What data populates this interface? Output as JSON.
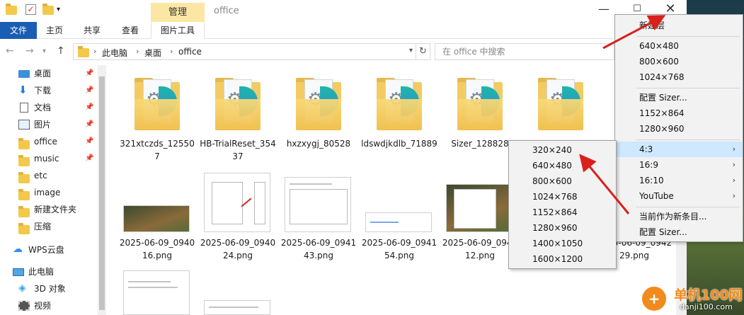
{
  "titlebar": {
    "manage_tab": "管理",
    "window_title": "office",
    "min_glyph": "—",
    "max_glyph": "☐",
    "close_glyph": "✕"
  },
  "ribbon": {
    "tabs": [
      "文件",
      "主页",
      "共享",
      "查看",
      "图片工具"
    ]
  },
  "address": {
    "crumbs": [
      "此电脑",
      "桌面",
      "office"
    ],
    "separator": "›",
    "search_placeholder": "在 office 中搜索"
  },
  "sidebar": {
    "items": [
      {
        "label": "桌面",
        "icon": "desktop-icon",
        "pinned": true
      },
      {
        "label": "下载",
        "icon": "download-icon",
        "pinned": true
      },
      {
        "label": "文档",
        "icon": "document-icon",
        "pinned": true
      },
      {
        "label": "图片",
        "icon": "picture-icon",
        "pinned": true
      },
      {
        "label": "office",
        "icon": "folder-icon",
        "pinned": true
      },
      {
        "label": "music",
        "icon": "folder-icon",
        "pinned": true
      },
      {
        "label": "etc",
        "icon": "folder-icon",
        "pinned": false
      },
      {
        "label": "image",
        "icon": "folder-icon",
        "pinned": false
      },
      {
        "label": "新建文件夹",
        "icon": "folder-icon",
        "pinned": false
      },
      {
        "label": "压缩",
        "icon": "folder-icon",
        "pinned": false
      },
      {
        "label": "WPS云盘",
        "icon": "cloud-icon",
        "pinned": false
      },
      {
        "label": "此电脑",
        "icon": "pc-icon",
        "pinned": false
      },
      {
        "label": "3D 对象",
        "icon": "3d-objects-icon",
        "pinned": false
      },
      {
        "label": "视频",
        "icon": "video-icon",
        "pinned": false
      }
    ]
  },
  "files": {
    "folders": [
      "321xtczds_125507",
      "HB-TrialReset_35437",
      "hxzxygj_80528",
      "ldswdjkdlb_71889",
      "Sizer_128828",
      ""
    ],
    "images": [
      "2025-06-09_094016.png",
      "2025-06-09_094024.png",
      "2025-06-09_094143.png",
      "2025-06-09_094154.png",
      "2025-06-09_094212.png",
      "2025-06-09_094229.png"
    ]
  },
  "menu_main": {
    "items": [
      "新建层",
      "640×480",
      "800×600",
      "1024×768",
      "配置 Sizer...",
      "1152×864",
      "1280×960",
      "4:3",
      "16:9",
      "16:10",
      "YouTube",
      "当前作为新条目...",
      "配置 Sizer..."
    ],
    "submenu_arrow": "›"
  },
  "menu_sub": {
    "items": [
      "320×240",
      "640×480",
      "800×600",
      "1024×768",
      "1152×864",
      "1280×960",
      "1400×1050",
      "1600×1200"
    ]
  },
  "watermark": {
    "logo": "+",
    "text": "单机100网",
    "url": "danji100.com"
  },
  "colors": {
    "file_tab": "#1a5eb4",
    "manage_tab": "#fbe7a3",
    "menu_highlight": "#cde8ff",
    "annotation_red": "#d9201c"
  }
}
